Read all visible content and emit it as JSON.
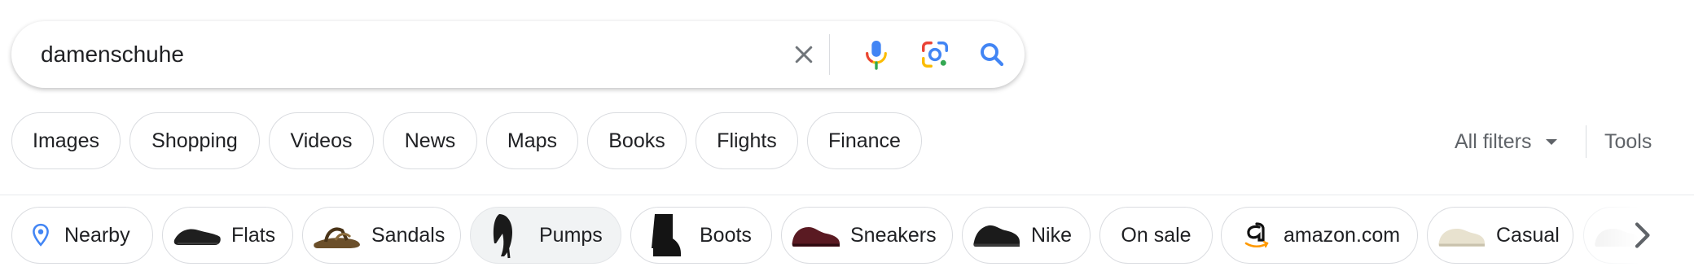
{
  "search": {
    "query": "damenschuhe"
  },
  "tabs": [
    "Images",
    "Shopping",
    "Videos",
    "News",
    "Maps",
    "Books",
    "Flights",
    "Finance"
  ],
  "filters": {
    "all_filters_label": "All filters",
    "tools_label": "Tools"
  },
  "refinements": [
    "Nearby",
    "Flats",
    "Sandals",
    "Pumps",
    "Boots",
    "Sneakers",
    "Nike",
    "On sale",
    "amazon.com",
    "Casual"
  ],
  "colors": {
    "google_blue": "#4285f4",
    "google_red": "#ea4335",
    "google_yellow": "#fbbc04",
    "google_green": "#34a853",
    "chip_border": "#dadce0",
    "selected_chip_bg": "#f1f3f4"
  },
  "icons": {
    "clear": "close-icon",
    "voice": "microphone-icon",
    "image_search": "camera-lens-icon",
    "search": "search-icon",
    "nearby": "location-pin-icon",
    "amazon": "amazon-logo-icon",
    "next": "chevron-right-icon"
  }
}
